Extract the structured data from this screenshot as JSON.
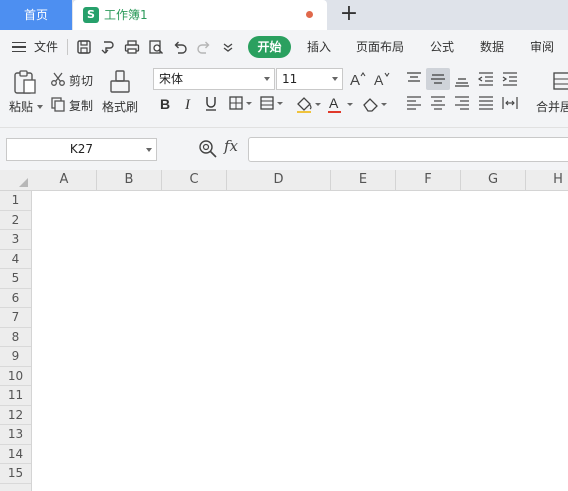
{
  "tabs": {
    "home": "首页",
    "workbook": "工作簿1",
    "workbook_icon": "S"
  },
  "menu": {
    "file": "文件",
    "items": [
      "开始",
      "插入",
      "页面布局",
      "公式",
      "数据",
      "审阅"
    ],
    "active": "开始"
  },
  "ribbon": {
    "paste": "粘贴",
    "cut": "剪切",
    "copy": "复制",
    "format_painter": "格式刷",
    "font_name": "宋体",
    "font_size": "11",
    "merge": "合并居"
  },
  "formula_bar": {
    "cell_ref": "K27",
    "fx": "fx",
    "formula": ""
  },
  "sheet": {
    "columns": [
      "A",
      "B",
      "C",
      "D",
      "E",
      "F",
      "G",
      "H"
    ],
    "rows": [
      "1",
      "2",
      "3",
      "4",
      "5",
      "6",
      "7",
      "8",
      "9",
      "10",
      "11",
      "12",
      "13",
      "14",
      "15"
    ]
  },
  "colors": {
    "accent_green": "#2aa05f",
    "home_tab_blue": "#4d8ff1",
    "unsaved_dot": "#e0684b"
  }
}
